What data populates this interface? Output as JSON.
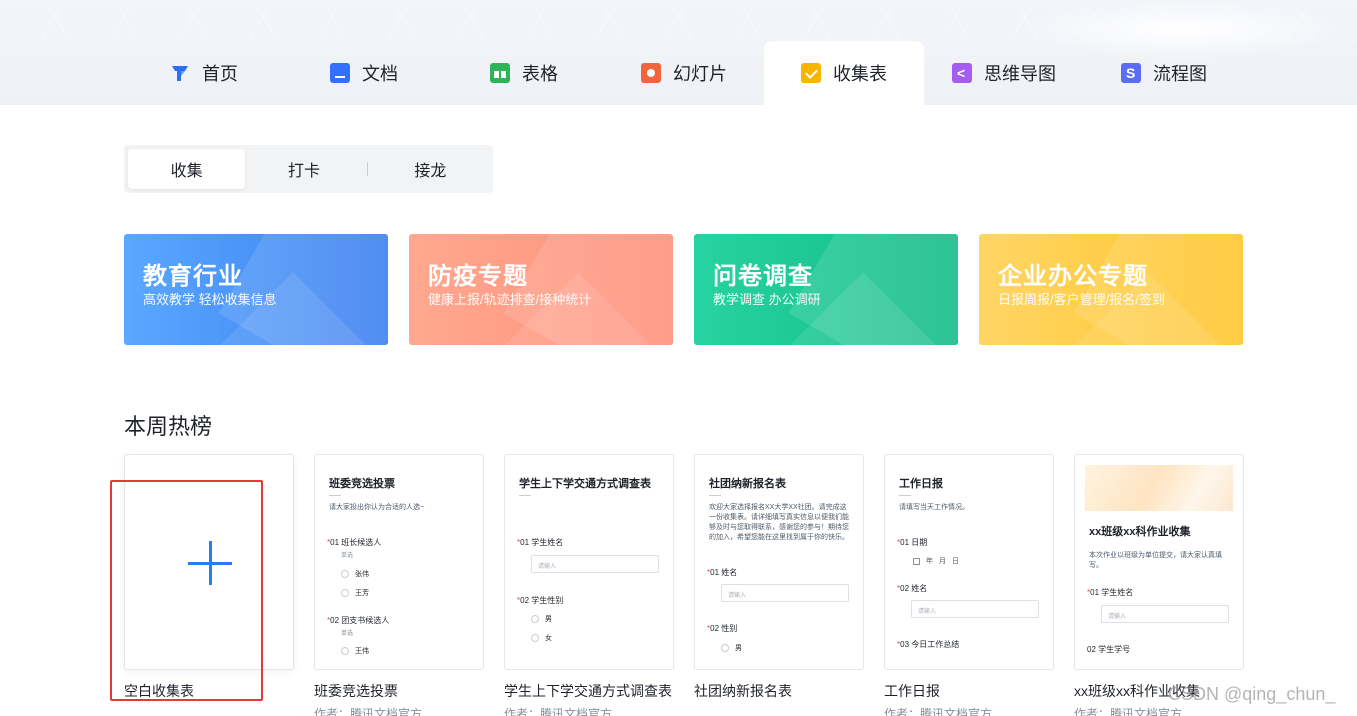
{
  "nav": {
    "tabs": [
      {
        "label": "首页",
        "icon": "home-icon"
      },
      {
        "label": "文档",
        "icon": "doc-icon"
      },
      {
        "label": "表格",
        "icon": "sheet-icon"
      },
      {
        "label": "幻灯片",
        "icon": "slide-icon"
      },
      {
        "label": "收集表",
        "icon": "form-icon",
        "active": true
      },
      {
        "label": "思维导图",
        "icon": "mindmap-icon"
      },
      {
        "label": "流程图",
        "icon": "flowchart-icon"
      }
    ]
  },
  "segment": {
    "items": [
      "收集",
      "打卡",
      "接龙"
    ],
    "active": "收集"
  },
  "banners": [
    {
      "title": "教育行业",
      "subtitle": "高效教学 轻松收集信息",
      "color": "#4a93f8"
    },
    {
      "title": "防疫专题",
      "subtitle": "健康上报/轨迹排查/接种统计",
      "color": "#ff9c85"
    },
    {
      "title": "问卷调查",
      "subtitle": "教学调查  办公调研",
      "color": "#1cc592"
    },
    {
      "title": "企业办公专题",
      "subtitle": "日报周报/客户管理/报名/签到",
      "color": "#ffcc45"
    }
  ],
  "section": {
    "title": "本周热榜"
  },
  "cards": {
    "blank": {
      "label": "空白收集表"
    },
    "c1": {
      "title": "班委竞选投票",
      "desc": "请大家投出你认为合适的人选~",
      "q1": "01  班长候选人",
      "q1_hint": "单选",
      "q1_opts": [
        "张伟",
        "王芳"
      ],
      "q2": "02  团支书候选人",
      "q2_hint": "单选",
      "q2_opts": [
        "王伟"
      ],
      "label": "班委竞选投票",
      "author": "作者：腾讯文档官方"
    },
    "c2": {
      "title": "学生上下学交通方式调查表",
      "q1": "01  学生姓名",
      "q1_input": "请输入",
      "q2": "02  学生性别",
      "q2_opts": [
        "男",
        "女"
      ],
      "label": "学生上下学交通方式调查表",
      "author": "作者：腾讯文档官方"
    },
    "c3": {
      "title": "社团纳新报名表",
      "desc": "欢迎大家选择报名XX大学XX社团。请完成这一份收集表。请详细填写真实信息以便我们能够及时与您取得联系，感谢您的参与！期待您的加入，希望您能在这里找到属于你的快乐。",
      "q1": "01  姓名",
      "q1_input": "请输入",
      "q2": "02  性别",
      "q2_opts": [
        "男"
      ],
      "label": "社团纳新报名表"
    },
    "c4": {
      "title": "工作日报",
      "desc": "请填写当天工作情况。",
      "q1": "01  日期",
      "date": [
        "年",
        "月",
        "日"
      ],
      "q2": "02  姓名",
      "q2_input": "请输入",
      "q3": "03  今日工作总结",
      "label": "工作日报",
      "author": "作者：腾讯文档官方"
    },
    "c5": {
      "title": "xx班级xx科作业收集",
      "desc": "本次作业以班级为单位提交，请大家认真填写。",
      "q1": "01  学生姓名",
      "q1_input": "请输入",
      "q2": "02  学生学号",
      "label": "xx班级xx科作业收集",
      "author": "作者：腾讯文档官方"
    }
  },
  "watermark": "CSDN @qing_chun_"
}
